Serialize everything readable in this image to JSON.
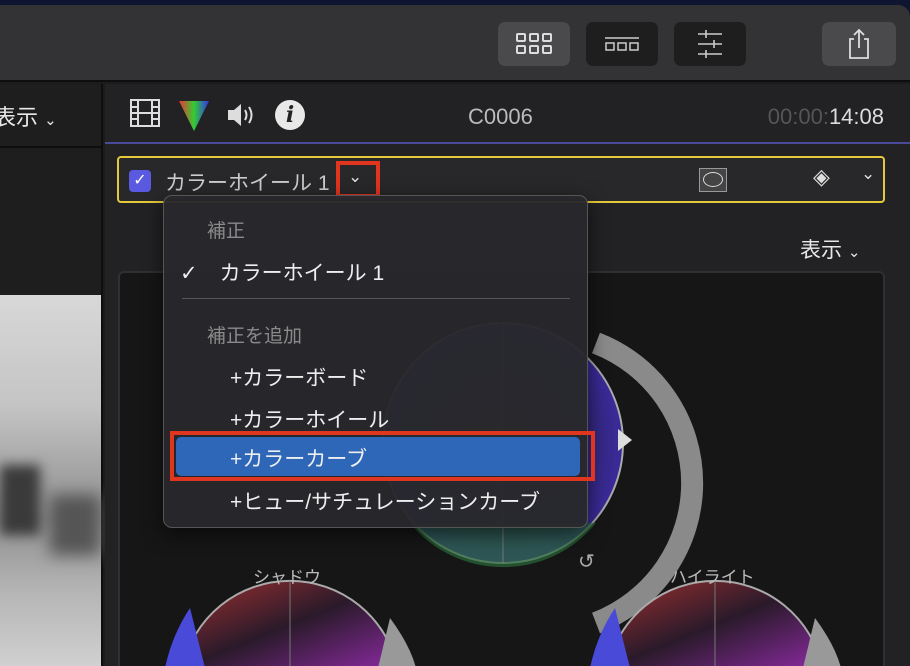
{
  "toolbar": {
    "buttons": [
      "browser-toggle",
      "timeline-toggle",
      "inspector-toggle",
      "share"
    ]
  },
  "left": {
    "view_label": "表示"
  },
  "inspector": {
    "clip_name": "C0006",
    "timecode_dim": "00:00:",
    "timecode": "14:08",
    "view_label": "表示"
  },
  "effect_row": {
    "name": "カラーホイール 1",
    "checked": true
  },
  "menu": {
    "section1": "補正",
    "current": "カラーホイール 1",
    "section2": "補正を追加",
    "items": [
      "+カラーボード",
      "+カラーホイール",
      "+カラーカーブ",
      "+ヒュー/サチュレーションカーブ"
    ],
    "highlighted_index": 2
  },
  "wheels": {
    "shadow": "シャドウ",
    "highlight": "ハイライト"
  },
  "colors": {
    "highlight": "#2e66b8",
    "annotation": "#e0351e",
    "selection_border": "#e5c93a",
    "checkbox": "#5a5ae0"
  }
}
